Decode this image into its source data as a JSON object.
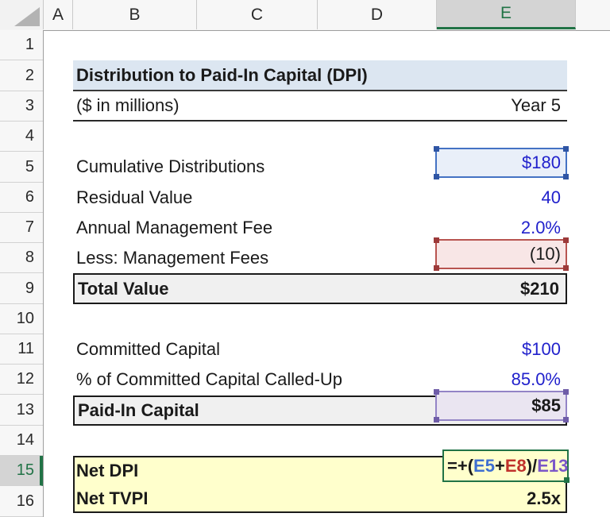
{
  "spreadsheet": {
    "column_headers": [
      "A",
      "B",
      "C",
      "D",
      "E"
    ],
    "selected_column": "E",
    "row_headers": [
      "1",
      "2",
      "3",
      "4",
      "5",
      "6",
      "7",
      "8",
      "9",
      "10",
      "11",
      "12",
      "13",
      "14",
      "15",
      "16"
    ],
    "selected_row": "15"
  },
  "header": {
    "title": "Distribution to Paid-In Capital (DPI)",
    "units_label": "($ in millions)",
    "period_label": "Year 5"
  },
  "cells": {
    "cumulative_distributions": {
      "label": "Cumulative Distributions",
      "value": "$180"
    },
    "residual_value": {
      "label": "Residual Value",
      "value": "40"
    },
    "annual_management_fee": {
      "label": "Annual Management Fee",
      "value": "2.0%"
    },
    "less_management_fees": {
      "label": "Less: Management Fees",
      "value": "(10)"
    },
    "total_value": {
      "label": "Total Value",
      "value": "$210"
    },
    "committed_capital": {
      "label": "Committed Capital",
      "value": "$100"
    },
    "pct_committed_called_up": {
      "label": "% of Committed Capital Called-Up",
      "value": "85.0%"
    },
    "paid_in_capital": {
      "label": "Paid-In Capital",
      "value": "$85"
    },
    "net_dpi": {
      "label": "Net DPI"
    },
    "net_tvpi": {
      "label": "Net TVPI",
      "value": "2.5x"
    }
  },
  "formula_editor": {
    "active_cell": "E15",
    "formula": "=+(E5+E8)/E13",
    "parts": [
      {
        "text": "=+(",
        "color": "#1a1a1a"
      },
      {
        "text": "E5",
        "color": "#3e6fd1"
      },
      {
        "text": "+",
        "color": "#1a1a1a"
      },
      {
        "text": "E8",
        "color": "#c0312b"
      },
      {
        "text": ")/",
        "color": "#1a1a1a"
      },
      {
        "text": "E13",
        "color": "#7b57c8"
      }
    ]
  },
  "colors": {
    "input_blue": "#2121cc",
    "selection_green": "#217346",
    "title_fill": "#dce6f1",
    "summary_fill": "#f0f0f0",
    "highlight_yellow": "#ffffcc",
    "ref_blue_border": "#4472c4",
    "ref_blue_fill": "#e9eff9",
    "ref_red_border": "#b85450",
    "ref_red_fill": "#f8e6e6",
    "ref_purple_border": "#9384c6",
    "ref_purple_fill": "#eae5f1"
  }
}
